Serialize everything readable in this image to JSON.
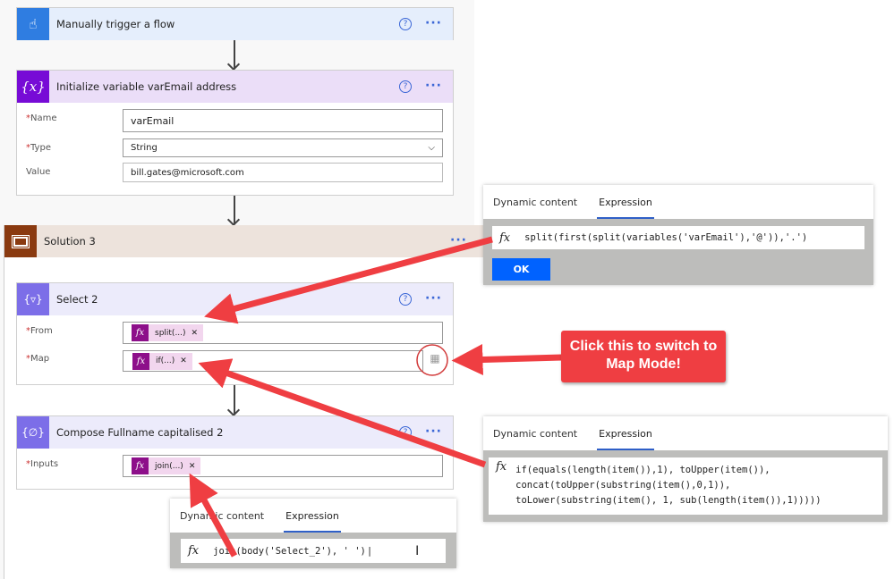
{
  "trigger": {
    "title": "Manually trigger a flow",
    "icon": "touch-hand-icon"
  },
  "init_variable": {
    "title": "Initialize variable varEmail address",
    "icon": "variable-icon",
    "fields": {
      "name_label": "Name",
      "name_value": "varEmail",
      "type_label": "Type",
      "type_value": "String",
      "value_label": "Value",
      "value_value": "bill.gates@microsoft.com"
    }
  },
  "scope": {
    "title": "Solution 3",
    "icon": "scope-icon"
  },
  "select": {
    "title": "Select 2",
    "icon": "select-icon",
    "from_label": "From",
    "from_token": "split(...)",
    "map_label": "Map",
    "map_token": "if(...)"
  },
  "compose": {
    "title": "Compose Fullname capitalised 2",
    "icon": "compose-icon",
    "inputs_label": "Inputs",
    "inputs_token": "join(...)"
  },
  "popups": {
    "tab_dynamic": "Dynamic content",
    "tab_expression": "Expression",
    "split_expression": "split(first(split(variables('varEmail'),'@')),'.')",
    "ok_label": "OK",
    "map_expression": [
      "if(equals(length(item()),1), toUpper(item()),",
      "concat(toUpper(substring(item(),0,1)),",
      "toLower(substring(item(), 1, sub(length(item()),1)))))"
    ],
    "join_expression": "join(body('Select_2'), ' ')"
  },
  "callout": {
    "line1": "Click this to switch to",
    "line2": "Map Mode!"
  },
  "colors": {
    "annotation_red": "#ef3e42",
    "ok_blue": "#0062ff",
    "trigger_blue": "#2f7de1",
    "variable_purple": "#770bd6",
    "scope_brown": "#8a3a10",
    "data_ops_purple": "#7c6ee8"
  }
}
